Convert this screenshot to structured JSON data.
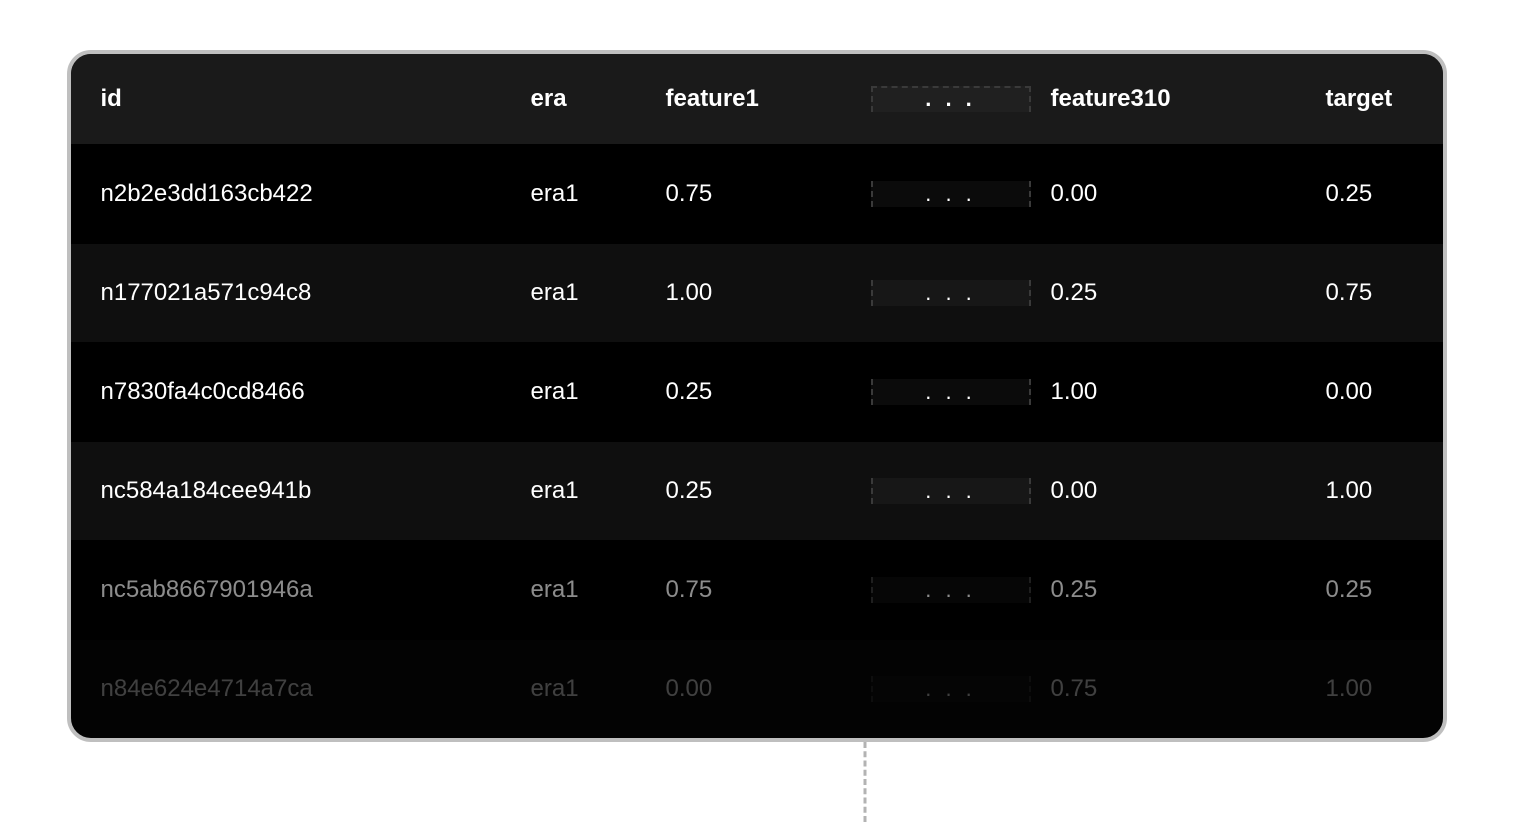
{
  "table": {
    "headers": {
      "id": "id",
      "era": "era",
      "feature1": "feature1",
      "ellipsis": ". . .",
      "feature310": "feature310",
      "target": "target"
    },
    "rows": [
      {
        "id": "n2b2e3dd163cb422",
        "era": "era1",
        "feature1": "0.75",
        "ellipsis": ". . .",
        "feature310": "0.00",
        "target": "0.25"
      },
      {
        "id": "n177021a571c94c8",
        "era": "era1",
        "feature1": "1.00",
        "ellipsis": ". . .",
        "feature310": "0.25",
        "target": "0.75"
      },
      {
        "id": "n7830fa4c0cd8466",
        "era": "era1",
        "feature1": "0.25",
        "ellipsis": ". . .",
        "feature310": "1.00",
        "target": "0.00"
      },
      {
        "id": "nc584a184cee941b",
        "era": "era1",
        "feature1": "0.25",
        "ellipsis": ". . .",
        "feature310": "0.00",
        "target": "1.00"
      },
      {
        "id": "nc5ab8667901946a",
        "era": "era1",
        "feature1": "0.75",
        "ellipsis": ". . .",
        "feature310": "0.25",
        "target": "0.25"
      },
      {
        "id": "n84e624e4714a7ca",
        "era": "era1",
        "feature1": "0.00",
        "ellipsis": ". . .",
        "feature310": "0.75",
        "target": "1.00"
      }
    ]
  }
}
